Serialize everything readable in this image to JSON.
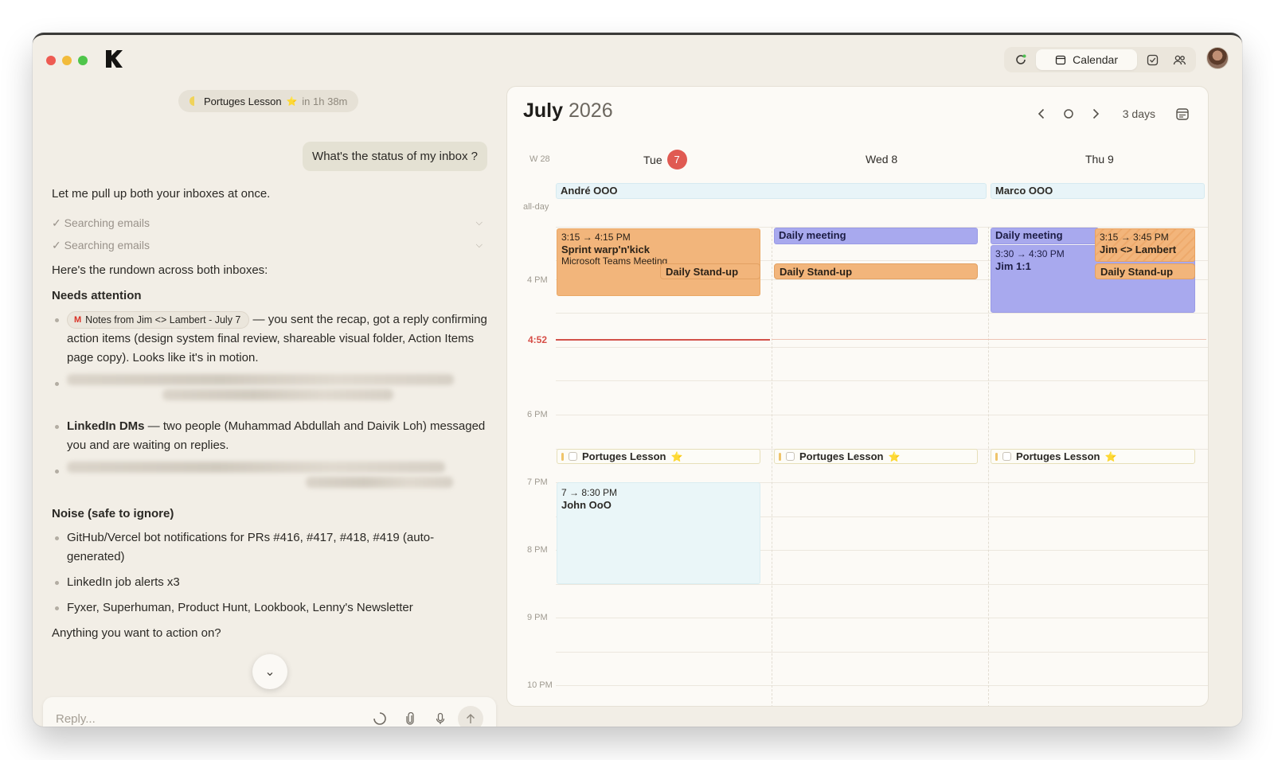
{
  "topbar": {
    "calendar_label": "Calendar",
    "icons": [
      "sync-icon",
      "calendar-icon",
      "tasks-check-icon",
      "people-icon"
    ]
  },
  "chat": {
    "upcoming_name": "Portuges Lesson",
    "upcoming_star": "⭐",
    "upcoming_time": "in 1h 38m",
    "user_message": "What's the status of my inbox ?",
    "intro": "Let me pull up both your inboxes at once.",
    "steps": [
      "✓ Searching emails",
      "✓ Searching emails"
    ],
    "rundown": "Here's the rundown across both inboxes:",
    "needs_heading": "Needs attention",
    "mail_chip": "Notes from Jim <> Lambert - July 7",
    "mail_text": " — you sent the recap, got a reply confirming action items (design system final review, shareable visual folder, Action Items page copy). Looks like it's in motion.",
    "linkedin_bold": "LinkedIn DMs",
    "linkedin_text": " — two people (Muhammad Abdullah and Daivik Loh) messaged you and are waiting on replies.",
    "noise_heading": "Noise (safe to ignore)",
    "noise_items": [
      "GitHub/Vercel bot notifications for PRs #416, #417, #418, #419 (auto-generated)",
      "LinkedIn job alerts x3",
      "Fyxer, Superhuman, Product Hunt, Lookbook, Lenny's Newsletter"
    ],
    "closing": "Anything you want to action on?",
    "reply_placeholder": "Reply..."
  },
  "calendar": {
    "month": "July",
    "year": "2026",
    "view": "3 days",
    "week_label": "W 28",
    "days": [
      {
        "name": "Tue",
        "num": "7",
        "today": true
      },
      {
        "name": "Wed 8",
        "num": "",
        "today": false
      },
      {
        "name": "Thu 9",
        "num": "",
        "today": false
      }
    ],
    "allday_label": "all-day",
    "allday_events": [
      "André OOO",
      "Marco OOO"
    ],
    "hours": [
      "4 PM",
      "6 PM",
      "7 PM",
      "8 PM",
      "9 PM",
      "10 PM"
    ],
    "now": "4:52",
    "events": {
      "sprint_time": "3:15 → 4:15 PM",
      "sprint_name": "Sprint warp'n'kick",
      "sprint_sub": "Microsoft Teams Meeting",
      "standup": "Daily Stand-up",
      "daily_meeting": "Daily meeting",
      "jim11_time": "3:30 → 4:30 PM",
      "jim11_name": "Jim 1:1",
      "lambert_time": "3:15 → 3:45 PM",
      "lambert_name": "Jim <> Lambert",
      "lesson": "Portuges Lesson",
      "lesson_star": "⭐",
      "john_time": "7 → 8:30 PM",
      "john_name": "John OoO"
    },
    "colors": {
      "accent_today": "#e05a52",
      "orange_event": "#f2b57b",
      "purple_event": "#a8a9ee",
      "now_line": "#d2524a"
    }
  }
}
